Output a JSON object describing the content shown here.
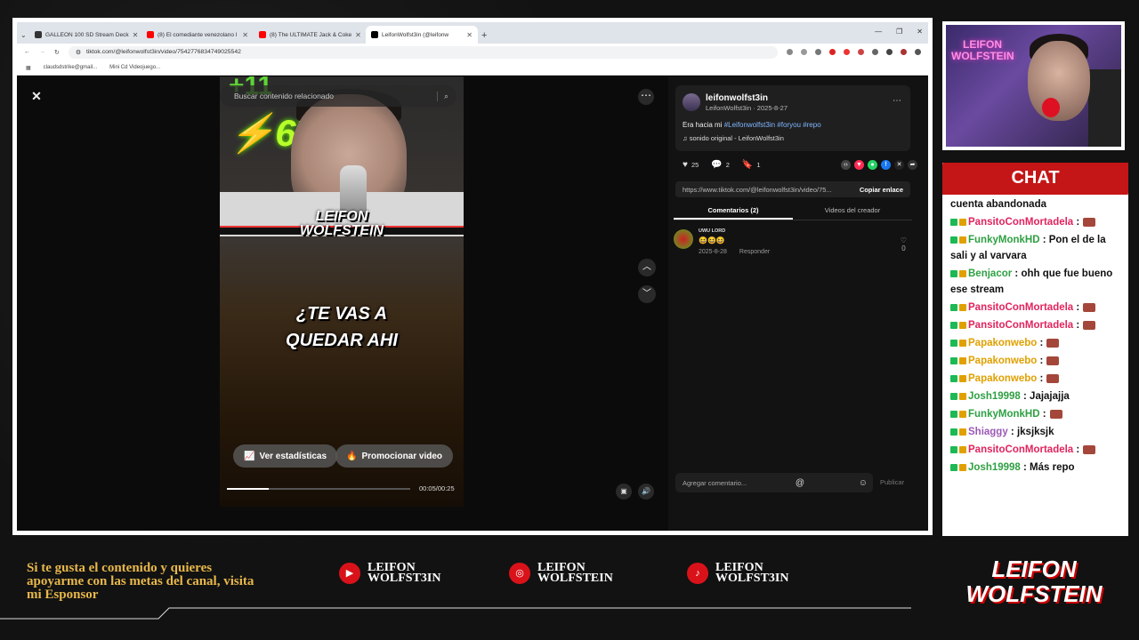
{
  "browser": {
    "tabs": [
      {
        "label": "GALLEON 100 SD Stream Deck",
        "color": "#333333"
      },
      {
        "label": "(8) El comediante venezolano l",
        "color": "#ff0000"
      },
      {
        "label": "(8) The ULTIMATE Jack & Coke",
        "color": "#ff0000"
      },
      {
        "label": "LeifonWolfst3in (@leifonw",
        "color": "#000000"
      }
    ],
    "new_tab": "+",
    "url": "tiktok.com/@leifonwolfst3in/video/7542776834749025542",
    "bookmarks": [
      "claudsdstrike@gmail...",
      "Mini Cd Videojuego..."
    ]
  },
  "video": {
    "search_placeholder": "Buscar contenido relacionado",
    "score_big": "67",
    "score_top": "+11",
    "brand_top": "LEIFON",
    "brand_bottom": "WOLFSTEIN",
    "caption_line1": "¿TE VAS A",
    "caption_line2": "QUEDAR AHI",
    "stats_button": "Ver estadísticas",
    "promote_button": "Promocionar video",
    "time": "00:05/00:25",
    "progress": 0.23
  },
  "post": {
    "username": "leifonwolfst3in",
    "subline": "LeifonWolfst3in · 2025-8-27",
    "desc_text": "Era hacia mi ",
    "desc_tags": "#Leifonwolfst3in #foryou #repo",
    "sound": "sonido original - LeifonWolfst3in",
    "likes": "25",
    "comments": "2",
    "saves": "1",
    "link": "https://www.tiktok.com/@leifonwolfst3in/video/75...",
    "copy_link": "Copiar enlace",
    "tab_comments": "Comentarios (2)",
    "tab_creator": "Videos del creador",
    "comment": {
      "name": "UWU LORD",
      "text": "😆😆😆",
      "date": "2025-8-28",
      "reply": "Responder",
      "likes": "0"
    },
    "add_comment_placeholder": "Agregar comentario...",
    "publish": "Publicar"
  },
  "cam": {
    "neon_sign": "LEIFON WOLFSTEIN"
  },
  "chat": {
    "title": "CHAT",
    "messages": [
      {
        "user": "",
        "color": "#111111",
        "text": "cuenta abandonada"
      },
      {
        "user": "PansitoConMortadela",
        "color": "#e0245e",
        "text": " :"
      },
      {
        "user": "FunkyMonkHD",
        "color": "#2ea043",
        "text": " : Pon el de la sali y al varvara"
      },
      {
        "user": "Benjacor",
        "color": "#2ea043",
        "text": " : ohh que fue bueno ese stream"
      },
      {
        "user": "PansitoConMortadela",
        "color": "#e0245e",
        "text": " :"
      },
      {
        "user": "PansitoConMortadela",
        "color": "#e0245e",
        "text": " :"
      },
      {
        "user": "Papakonwebo",
        "color": "#e0a000",
        "text": " :"
      },
      {
        "user": "Papakonwebo",
        "color": "#e0a000",
        "text": " :"
      },
      {
        "user": "Papakonwebo",
        "color": "#e0a000",
        "text": " :"
      },
      {
        "user": "Josh19998",
        "color": "#2ea043",
        "text": " : Jajajajja"
      },
      {
        "user": "FunkyMonkHD",
        "color": "#2ea043",
        "text": " :"
      },
      {
        "user": "Shiaggy",
        "color": "#9b59b6",
        "text": " : jksjksjk"
      },
      {
        "user": "PansitoConMortadela",
        "color": "#e0245e",
        "text": " :"
      },
      {
        "user": "Josh19998",
        "color": "#2ea043",
        "text": " : Más repo"
      }
    ]
  },
  "overlay": {
    "sponsor_text": "Si te gusta el contenido y quieres apoyarme con las metas del canal, visita mi Esponsor",
    "socials": [
      {
        "icon": "youtube-icon",
        "line1": "LEIFON",
        "line2": "WOLFST3IN"
      },
      {
        "icon": "instagram-icon",
        "line1": "LEIFON",
        "line2": "WOLFSTEIN"
      },
      {
        "icon": "tiktok-icon",
        "line1": "LEIFON",
        "line2": "WOLFST3IN"
      }
    ],
    "logo_line1": "LEIFON",
    "logo_line2": "WOLFSTEIN"
  }
}
